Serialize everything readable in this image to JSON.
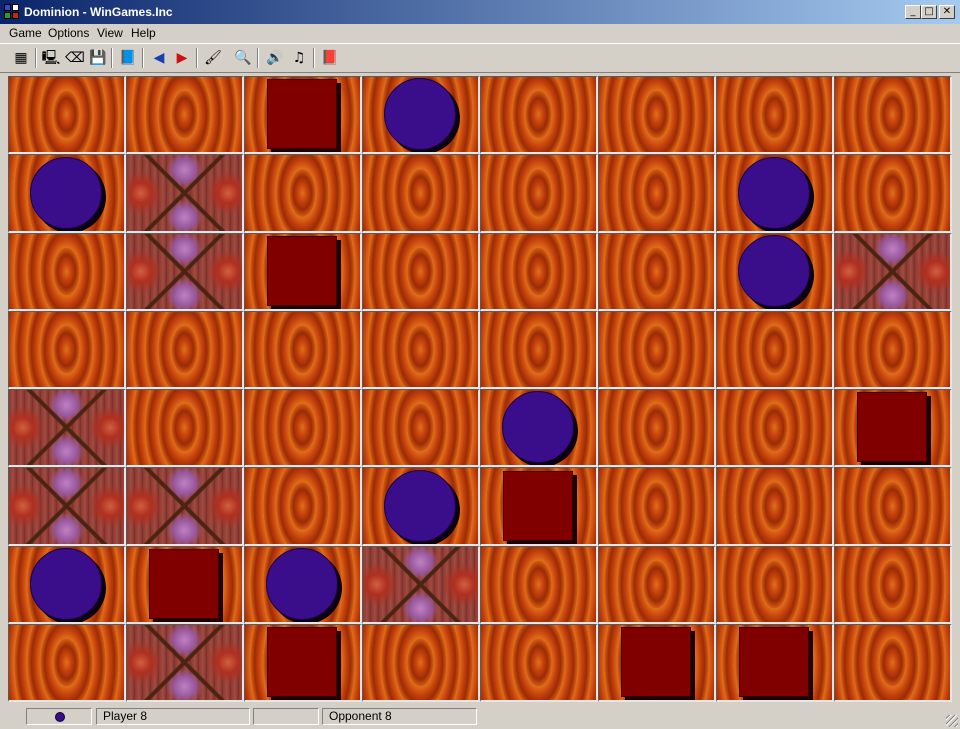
{
  "window": {
    "title": "Dominion - WinGames.Inc"
  },
  "title_buttons": {
    "minimize": "_",
    "maximize": "□",
    "close": "✕"
  },
  "menu": [
    {
      "label": "Game"
    },
    {
      "label": "Options"
    },
    {
      "label": "View"
    },
    {
      "label": "Help"
    }
  ],
  "toolbar": {
    "tools": [
      {
        "name": "new-game-icon",
        "glyph": "▦"
      },
      {
        "name": "computer-icon",
        "glyph": "🖳"
      },
      {
        "name": "open-icon",
        "glyph": "⌫"
      },
      {
        "name": "save-icon",
        "glyph": "💾"
      },
      {
        "name": "book-icon",
        "glyph": "📘"
      },
      {
        "name": "undo-icon",
        "glyph": "◀"
      },
      {
        "name": "redo-icon",
        "glyph": "▶"
      },
      {
        "name": "brush-icon",
        "glyph": "🖌"
      },
      {
        "name": "hint-icon",
        "glyph": "🔍"
      },
      {
        "name": "sound-icon",
        "glyph": "🔊"
      },
      {
        "name": "music-icon",
        "glyph": "♫"
      },
      {
        "name": "help-book-icon",
        "glyph": "📕"
      }
    ]
  },
  "board": {
    "rows": 8,
    "cols": 8,
    "cells": [
      [
        "empty",
        "empty",
        "opponent",
        "player",
        "empty",
        "empty",
        "empty",
        "empty"
      ],
      [
        "player",
        "special",
        "empty",
        "empty",
        "empty",
        "empty",
        "player",
        "empty"
      ],
      [
        "empty",
        "special",
        "opponent",
        "empty",
        "empty",
        "empty",
        "player",
        "special"
      ],
      [
        "empty",
        "empty",
        "empty",
        "empty",
        "empty",
        "empty",
        "empty",
        "empty"
      ],
      [
        "special",
        "empty",
        "empty",
        "empty",
        "player",
        "empty",
        "empty",
        "opponent"
      ],
      [
        "special",
        "special",
        "empty",
        "player",
        "opponent",
        "empty",
        "empty",
        "empty"
      ],
      [
        "player",
        "opponent",
        "player",
        "special",
        "empty",
        "empty",
        "empty",
        "empty"
      ],
      [
        "empty",
        "special",
        "opponent",
        "empty",
        "empty",
        "opponent",
        "opponent",
        "empty"
      ]
    ]
  },
  "status": {
    "player_label": "Player  8",
    "opponent_label": "Opponent  8"
  },
  "colors": {
    "player_piece": "#3a0d8a",
    "opponent_piece": "#800000",
    "board_tile": "#cc4f0a"
  }
}
